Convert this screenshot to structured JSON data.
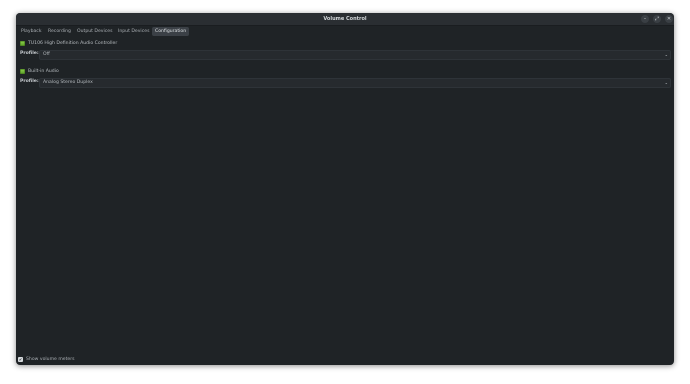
{
  "window": {
    "title": "Volume Control",
    "controls": {
      "minimize_icon": "minimize-icon",
      "maximize_icon": "maximize-icon",
      "close_icon": "close-icon",
      "minimize_glyph": "–",
      "maximize_glyph": "⤢",
      "close_glyph": "✕"
    }
  },
  "tabs": [
    {
      "label": "Playback"
    },
    {
      "label": "Recording"
    },
    {
      "label": "Output Devices"
    },
    {
      "label": "Input Devices"
    },
    {
      "label": "Configuration",
      "active": true
    }
  ],
  "devices": [
    {
      "name": "TU106 High Definition Audio Controller",
      "profile_label": "Profile:",
      "profile_value": "Off"
    },
    {
      "name": "Built-in Audio",
      "profile_label": "Profile:",
      "profile_value": "Analog Stereo Duplex"
    }
  ],
  "footer": {
    "show_meters_label": "Show volume meters",
    "show_meters_checked": true,
    "check_glyph": "✔"
  },
  "colors": {
    "background": "#1f2326",
    "titlebar": "#2a2e32",
    "active_tab": "#3b4046",
    "device_icon": "#7cc23a"
  },
  "ui": {
    "chevron_glyph": "⌄"
  }
}
